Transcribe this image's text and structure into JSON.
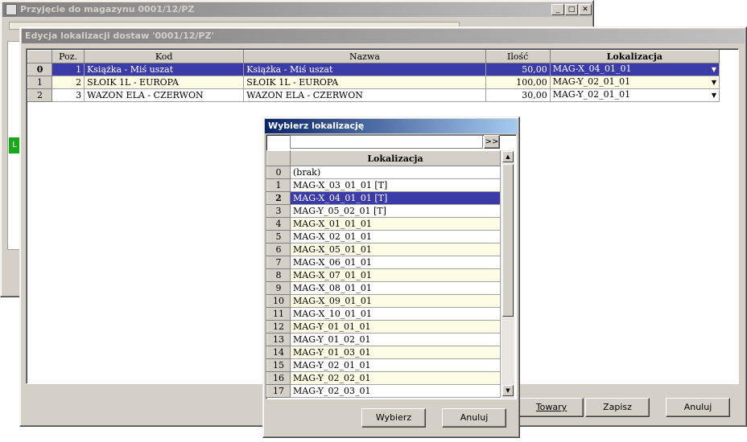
{
  "background_window": {
    "title": "Przyjęcie do magazynu 0001/12/PZ",
    "controls": [
      "_",
      "□",
      "✕"
    ],
    "left_strip_label": "L"
  },
  "main_dialog": {
    "title": "Edycja lokalizacji dostaw '0001/12/PZ'",
    "columns": [
      "Poz.",
      "Kod",
      "Nazwa",
      "Ilość",
      "Lokalizacja"
    ],
    "rows": [
      {
        "rownum": "0",
        "poz": "1",
        "kod": "Książka - Miś uszat",
        "nazwa": "Książka - Miś uszat",
        "ilosc": "50,00",
        "lokalizacja": "MAG-X_04_01_01",
        "selected": true
      },
      {
        "rownum": "1",
        "poz": "2",
        "kod": "SŁOIK 1L - EUROPA",
        "nazwa": "SŁOIK 1L - EUROPA",
        "ilosc": "100,00",
        "lokalizacja": "MAG-Y_02_01_01",
        "selected": false
      },
      {
        "rownum": "2",
        "poz": "3",
        "kod": "WAZON ELA - CZERWON",
        "nazwa": "WAZON ELA - CZERWON",
        "ilosc": "30,00",
        "lokalizacja": "MAG-Y_02_01_01",
        "selected": false
      }
    ],
    "buttons": {
      "towary": "Towary",
      "zapisz": "Zapisz",
      "anuluj": "Anuluj"
    }
  },
  "picker": {
    "title": "Wybierz lokalizację",
    "search_value": "",
    "search_button": ">>",
    "column": "Lokalizacja",
    "selected_index": 2,
    "items": [
      {
        "n": "0",
        "v": "(brak)"
      },
      {
        "n": "1",
        "v": "MAG-X_03_01_01 [T]"
      },
      {
        "n": "2",
        "v": "MAG-X_04_01_01 [T]"
      },
      {
        "n": "3",
        "v": "MAG-Y_05_02_01 [T]"
      },
      {
        "n": "4",
        "v": "MAG-X_01_01_01"
      },
      {
        "n": "5",
        "v": "MAG-X_02_01_01"
      },
      {
        "n": "6",
        "v": "MAG-X_05_01_01"
      },
      {
        "n": "7",
        "v": "MAG-X_06_01_01"
      },
      {
        "n": "8",
        "v": "MAG-X_07_01_01"
      },
      {
        "n": "9",
        "v": "MAG-X_08_01_01"
      },
      {
        "n": "10",
        "v": "MAG-X_09_01_01"
      },
      {
        "n": "11",
        "v": "MAG-X_10_01_01"
      },
      {
        "n": "12",
        "v": "MAG-Y_01_01_01"
      },
      {
        "n": "13",
        "v": "MAG-Y_01_02_01"
      },
      {
        "n": "14",
        "v": "MAG-Y_01_03_01"
      },
      {
        "n": "15",
        "v": "MAG-Y_02_01_01"
      },
      {
        "n": "16",
        "v": "MAG-Y_02_02_01"
      },
      {
        "n": "17",
        "v": "MAG-Y_02_03_01"
      }
    ],
    "buttons": {
      "wybierz": "Wybierz",
      "anuluj": "Anuluj"
    }
  }
}
